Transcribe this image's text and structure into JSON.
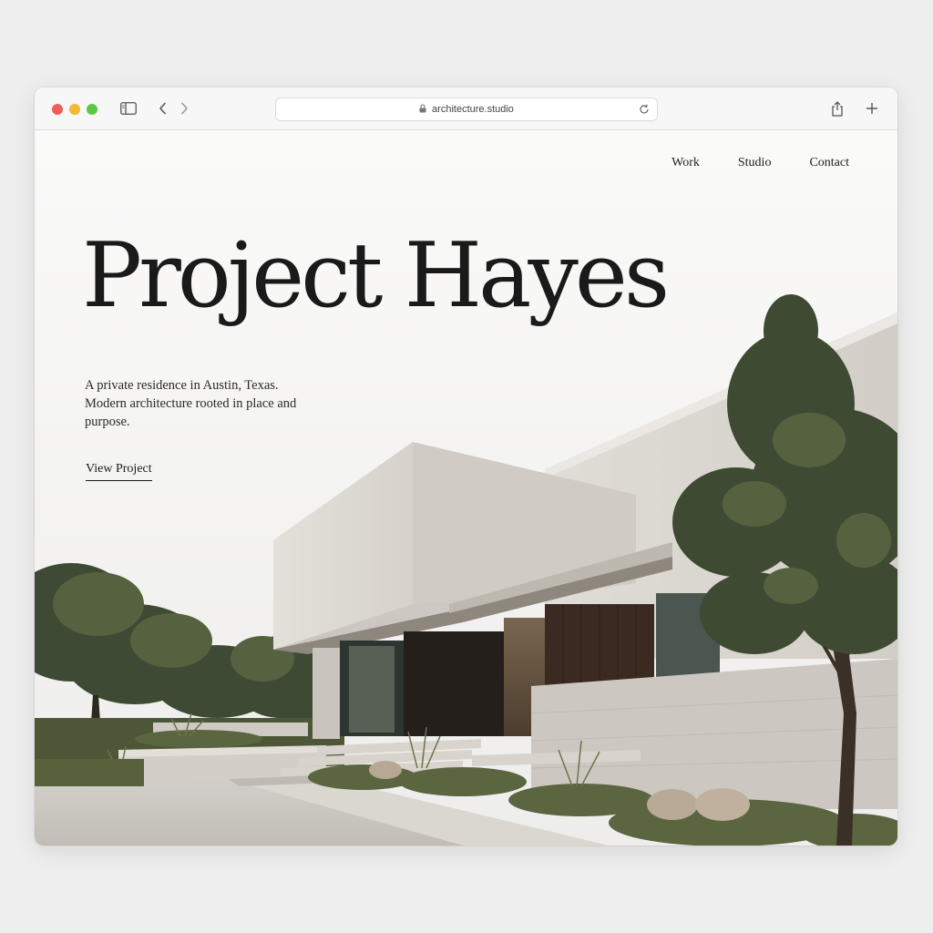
{
  "browser": {
    "url": "architecture.studio",
    "icons": [
      "close-dot",
      "minimize-dot",
      "maximize-dot",
      "sidebar-icon",
      "back-icon",
      "forward-icon",
      "lock-icon",
      "reload-icon",
      "share-icon",
      "new-tab-icon"
    ]
  },
  "nav": {
    "work": "Work",
    "studio": "Studio",
    "contact": "Contact"
  },
  "hero": {
    "title": "Project Hayes",
    "description": "A private residence in Austin, Texas. Modern architecture rooted in place and purpose.",
    "cta": "View Project"
  },
  "colors": {
    "close": "#ee5f57",
    "minimize": "#f0b937",
    "maximize": "#5bc845",
    "text": "#1a1a1a",
    "page_bg": "#fafaf9"
  }
}
